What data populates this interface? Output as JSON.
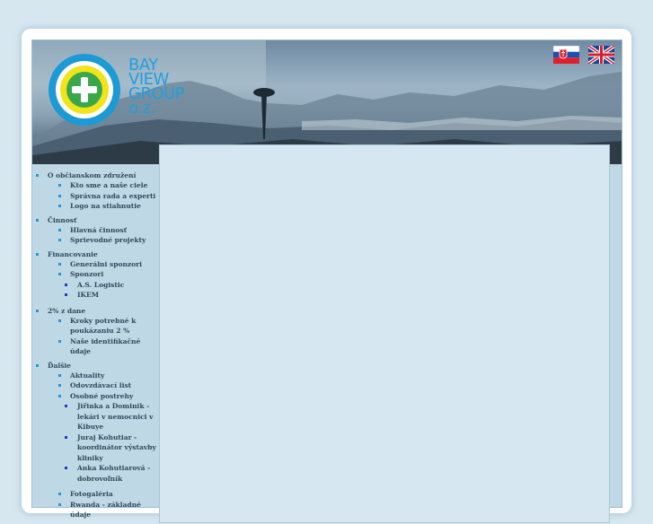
{
  "logo": {
    "line1": "BAY",
    "line2": "VIEW",
    "line3": "GROUP",
    "line4": "o.z."
  },
  "flags": {
    "sk": "slovak-flag",
    "en": "uk-flag"
  },
  "colors": {
    "accent": "#1f9fe0",
    "content_bg": "#d7e7f1",
    "sidebar_bg": "#bfd8e6"
  },
  "menu": {
    "o_zdruzeni": "O občianskom združení",
    "kto_sme": "Kto sme a naše ciele",
    "spravna_rada": "Správna rada a experti",
    "logo_stiahnutie": "Logo na stiahnutie",
    "cinnost": "Činnosť",
    "hlavna_cinnost": "Hlavná činnosť",
    "sprievodne": "Sprievodné projekty",
    "financovanie": "Financovanie",
    "generalni": "Generálni sponzori",
    "sponzori": "Sponzori",
    "as_logistic": "A.S. Logistic",
    "ikem": "IKEM",
    "dve_percenta": "2% z dane",
    "kroky": "Kroky potrebné k poukázaniu 2 %",
    "identifikacne": "Naše identifikačné údaje",
    "dalsie": "Ďalšie",
    "aktuality": "Aktuality",
    "odovzdavaci": "Odovzdávací list",
    "osobne": "Osobné postrehy",
    "jirinka": "Jiřinka a Dominik - lekári v nemocnici v Kibuye",
    "juraj": "Juraj Kohutiar - koordinátor výstavby kliniky",
    "anka": "Anka Kohutiarová - dobrovoľník",
    "fotogaleria": "Fotogaléria",
    "rwanda": "Rwanda - základné údaje"
  }
}
